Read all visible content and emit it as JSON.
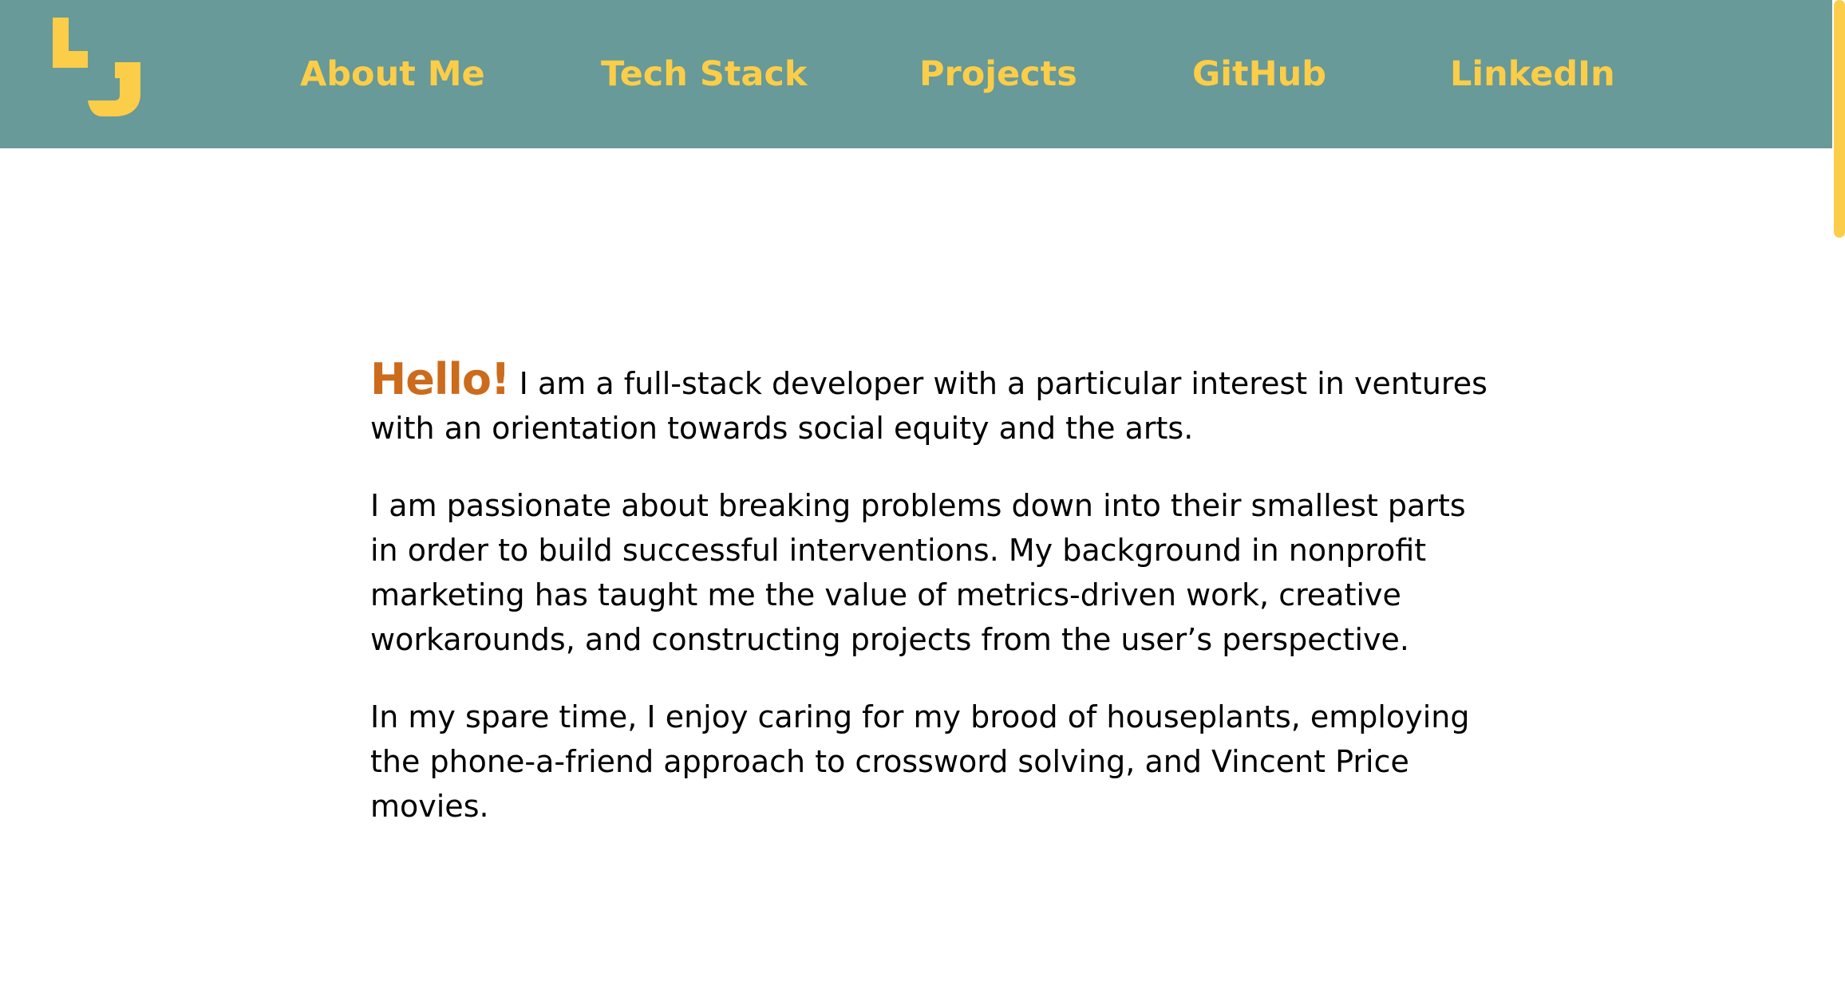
{
  "header": {
    "logo_alt": "LJ",
    "nav": [
      {
        "label": "About Me"
      },
      {
        "label": "Tech Stack"
      },
      {
        "label": "Projects"
      },
      {
        "label": "GitHub"
      },
      {
        "label": "LinkedIn"
      }
    ]
  },
  "about": {
    "greeting": "Hello!",
    "intro": "I am a full-stack developer with a particular interest in ventures with an orientation towards social equity and the arts.",
    "paragraph_2": "I am passionate about breaking problems down into their smallest parts in order to build successful interventions. My background in nonprofit marketing has taught me the value of metrics-driven work, creative workarounds, and constructing projects from the user’s perspective.",
    "paragraph_3": "In my spare time, I enjoy caring for my brood of houseplants, employing the phone-a-friend approach to crossword solving, and Vincent Price movies."
  },
  "colors": {
    "header_bg": "#679a98",
    "accent_yellow": "#fccd48",
    "greeting_orange": "#cc6b1c",
    "body_text": "#000000"
  }
}
